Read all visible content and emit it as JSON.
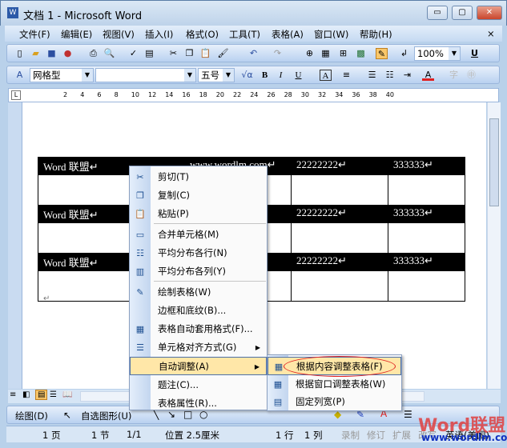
{
  "window": {
    "title": "文档 1 - Microsoft Word",
    "minimize": "▭",
    "maximize": "▢",
    "close": "✕"
  },
  "menubar": {
    "items": [
      "文件(F)",
      "编辑(E)",
      "视图(V)",
      "插入(I)",
      "格式(O)",
      "工具(T)",
      "表格(A)",
      "窗口(W)",
      "帮助(H)"
    ],
    "close": "×"
  },
  "standard_toolbar": {
    "zoom": "100%"
  },
  "format_toolbar": {
    "style": "网格型",
    "font": "",
    "size": "五号",
    "bold": "B",
    "italic": "I",
    "underline": "U",
    "char_border": "A",
    "font_color": "A"
  },
  "ruler": {
    "ticks": [
      "2",
      "4",
      "6",
      "8",
      "10",
      "12",
      "14",
      "16",
      "18",
      "20",
      "22",
      "24",
      "26",
      "28",
      "30",
      "32",
      "34",
      "36",
      "38",
      "40"
    ],
    "corner": "L"
  },
  "table": {
    "rows": [
      [
        "Word 联盟↵",
        "www.wordlm.com↵",
        "22222222↵",
        "333333↵"
      ],
      [
        "Word 联盟↵",
        "",
        "22222222↵",
        "333333↵"
      ],
      [
        "Word 联盟↵",
        "",
        "22222222↵",
        "333333↵"
      ]
    ]
  },
  "paragraph_mark": "↵",
  "context_menu": {
    "items": [
      {
        "label": "剪切(T)",
        "icon": "scissors-icon"
      },
      {
        "label": "复制(C)",
        "icon": "copy-icon"
      },
      {
        "label": "粘贴(P)",
        "icon": "paste-icon"
      },
      {
        "label": "合并单元格(M)",
        "icon": "merge-cells-icon"
      },
      {
        "label": "平均分布各行(N)",
        "icon": "distribute-rows-icon"
      },
      {
        "label": "平均分布各列(Y)",
        "icon": "distribute-columns-icon"
      },
      {
        "label": "绘制表格(W)",
        "icon": "draw-table-icon"
      },
      {
        "label": "边框和底纹(B)...",
        "icon": ""
      },
      {
        "label": "表格自动套用格式(F)...",
        "icon": "autoformat-icon"
      },
      {
        "label": "单元格对齐方式(G)",
        "icon": "cell-align-icon"
      },
      {
        "label": "自动调整(A)",
        "icon": ""
      },
      {
        "label": "题注(C)...",
        "icon": ""
      },
      {
        "label": "表格属性(R)...",
        "icon": ""
      }
    ]
  },
  "submenu": {
    "items": [
      "根据内容调整表格(F)",
      "根据窗口调整表格(W)",
      "固定列宽(P)"
    ]
  },
  "drawing_toolbar": {
    "draw": "绘图(D)",
    "autoshapes": "自选图形(U)"
  },
  "statusbar": {
    "page": "1 页",
    "section": "1 节",
    "pages": "1/1",
    "position": "位置 2.5厘米",
    "line": "1 行",
    "column": "1 列",
    "rec": "录制",
    "trk": "修订",
    "ext": "扩展",
    "ovr": "改写",
    "lang": "英语(美国)"
  },
  "watermark": {
    "brand": "Word联盟",
    "url": "www.wordlm.com"
  },
  "colors": {
    "highlight": "#ffe7a8",
    "annotation": "#e02020"
  }
}
